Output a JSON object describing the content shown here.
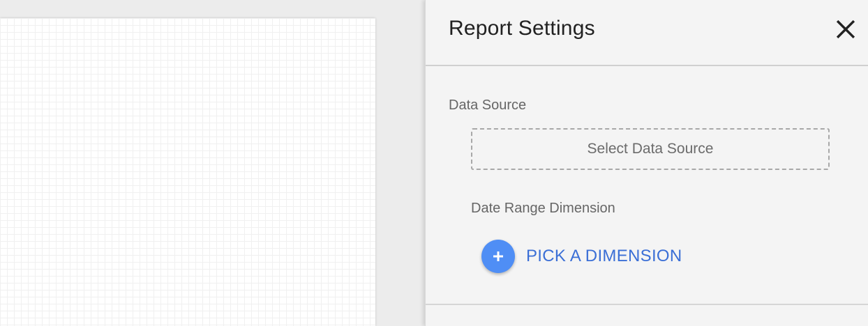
{
  "panel": {
    "title": "Report Settings",
    "close_icon": "close-icon"
  },
  "data_source": {
    "label": "Data Source",
    "button_label": "Select Data Source"
  },
  "date_range": {
    "label": "Date Range Dimension",
    "pick_label": "PICK A DIMENSION",
    "plus_icon": "plus-icon"
  },
  "colors": {
    "accent": "#4f8ef5",
    "link": "#3b6fd6",
    "panel_bg": "#f4f4f4"
  }
}
